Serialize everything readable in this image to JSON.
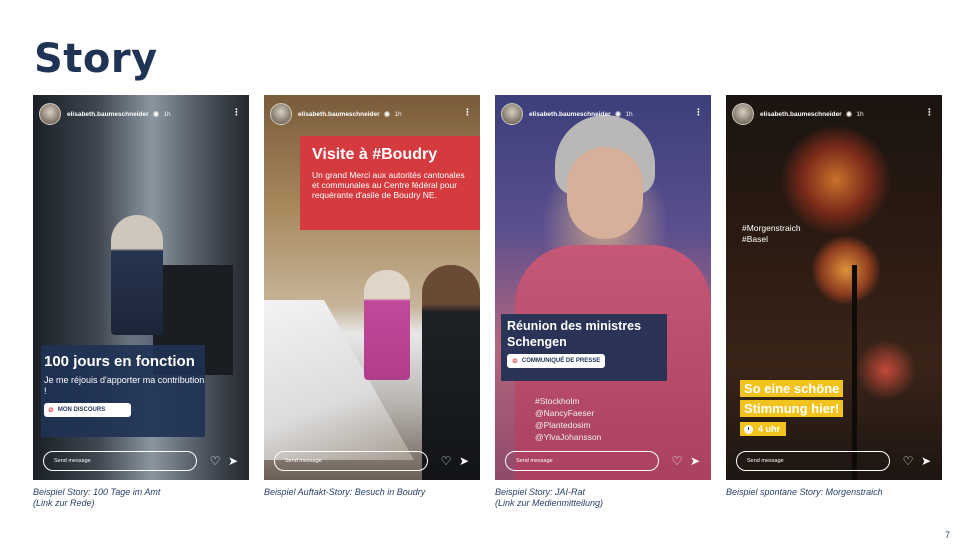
{
  "title": "Story",
  "page_number": "7",
  "stories": [
    {
      "username": "elisabeth.baumeschneider",
      "time": "1h",
      "headline": "100 jours en fonction",
      "text": "Je me réjouis d'apporter ma contribution !",
      "pill": "MON DISCOURS",
      "send_message": "Send message",
      "caption": "Beispiel Story: 100 Tage im Amt\n(Link zur Rede)"
    },
    {
      "username": "elisabeth.baumeschneider",
      "time": "1h",
      "headline": "Visite à #Boudry",
      "text": "Un grand Merci aux autorités cantonales et communales au Centre fédéral pour requérante d'asile de Boudry NE.",
      "send_message": "Send message",
      "caption": "Beispiel Auftakt-Story: Besuch in Boudry"
    },
    {
      "username": "elisabeth.baumeschneider",
      "time": "1h",
      "headline": "Réunion des ministres Schengen",
      "pill": "COMMUNIQUÉ DE PRESSE",
      "tags": [
        "#Stockholm",
        "@NancyFaeser",
        "@Plantedosim",
        "@YlvaJohansson"
      ],
      "send_message": "Send message",
      "caption": "Beispiel Story: JAI-Rat\n(Link zur Medienmitteilung)"
    },
    {
      "username": "elisabeth.baumeschneider",
      "time": "1h",
      "tags": [
        "#Morgenstraich",
        "#Basel"
      ],
      "headline": "So eine schöne Stimmung hier!",
      "clock_label": "4 uhr",
      "send_message": "Send message",
      "caption": "Beispiel spontane Story: Morgenstraich"
    }
  ],
  "icons": {
    "verified": "verified-badge-icon",
    "more": "more-options-icon",
    "like": "heart-icon",
    "share": "send-icon",
    "link": "link-icon",
    "clock": "clock-icon"
  },
  "colors": {
    "title": "#1f3355",
    "story_box_navy": "#1f3254",
    "boudry_red": "#d43a3e",
    "highlight_yellow": "#f2c31c",
    "caption": "#2a3f66"
  }
}
